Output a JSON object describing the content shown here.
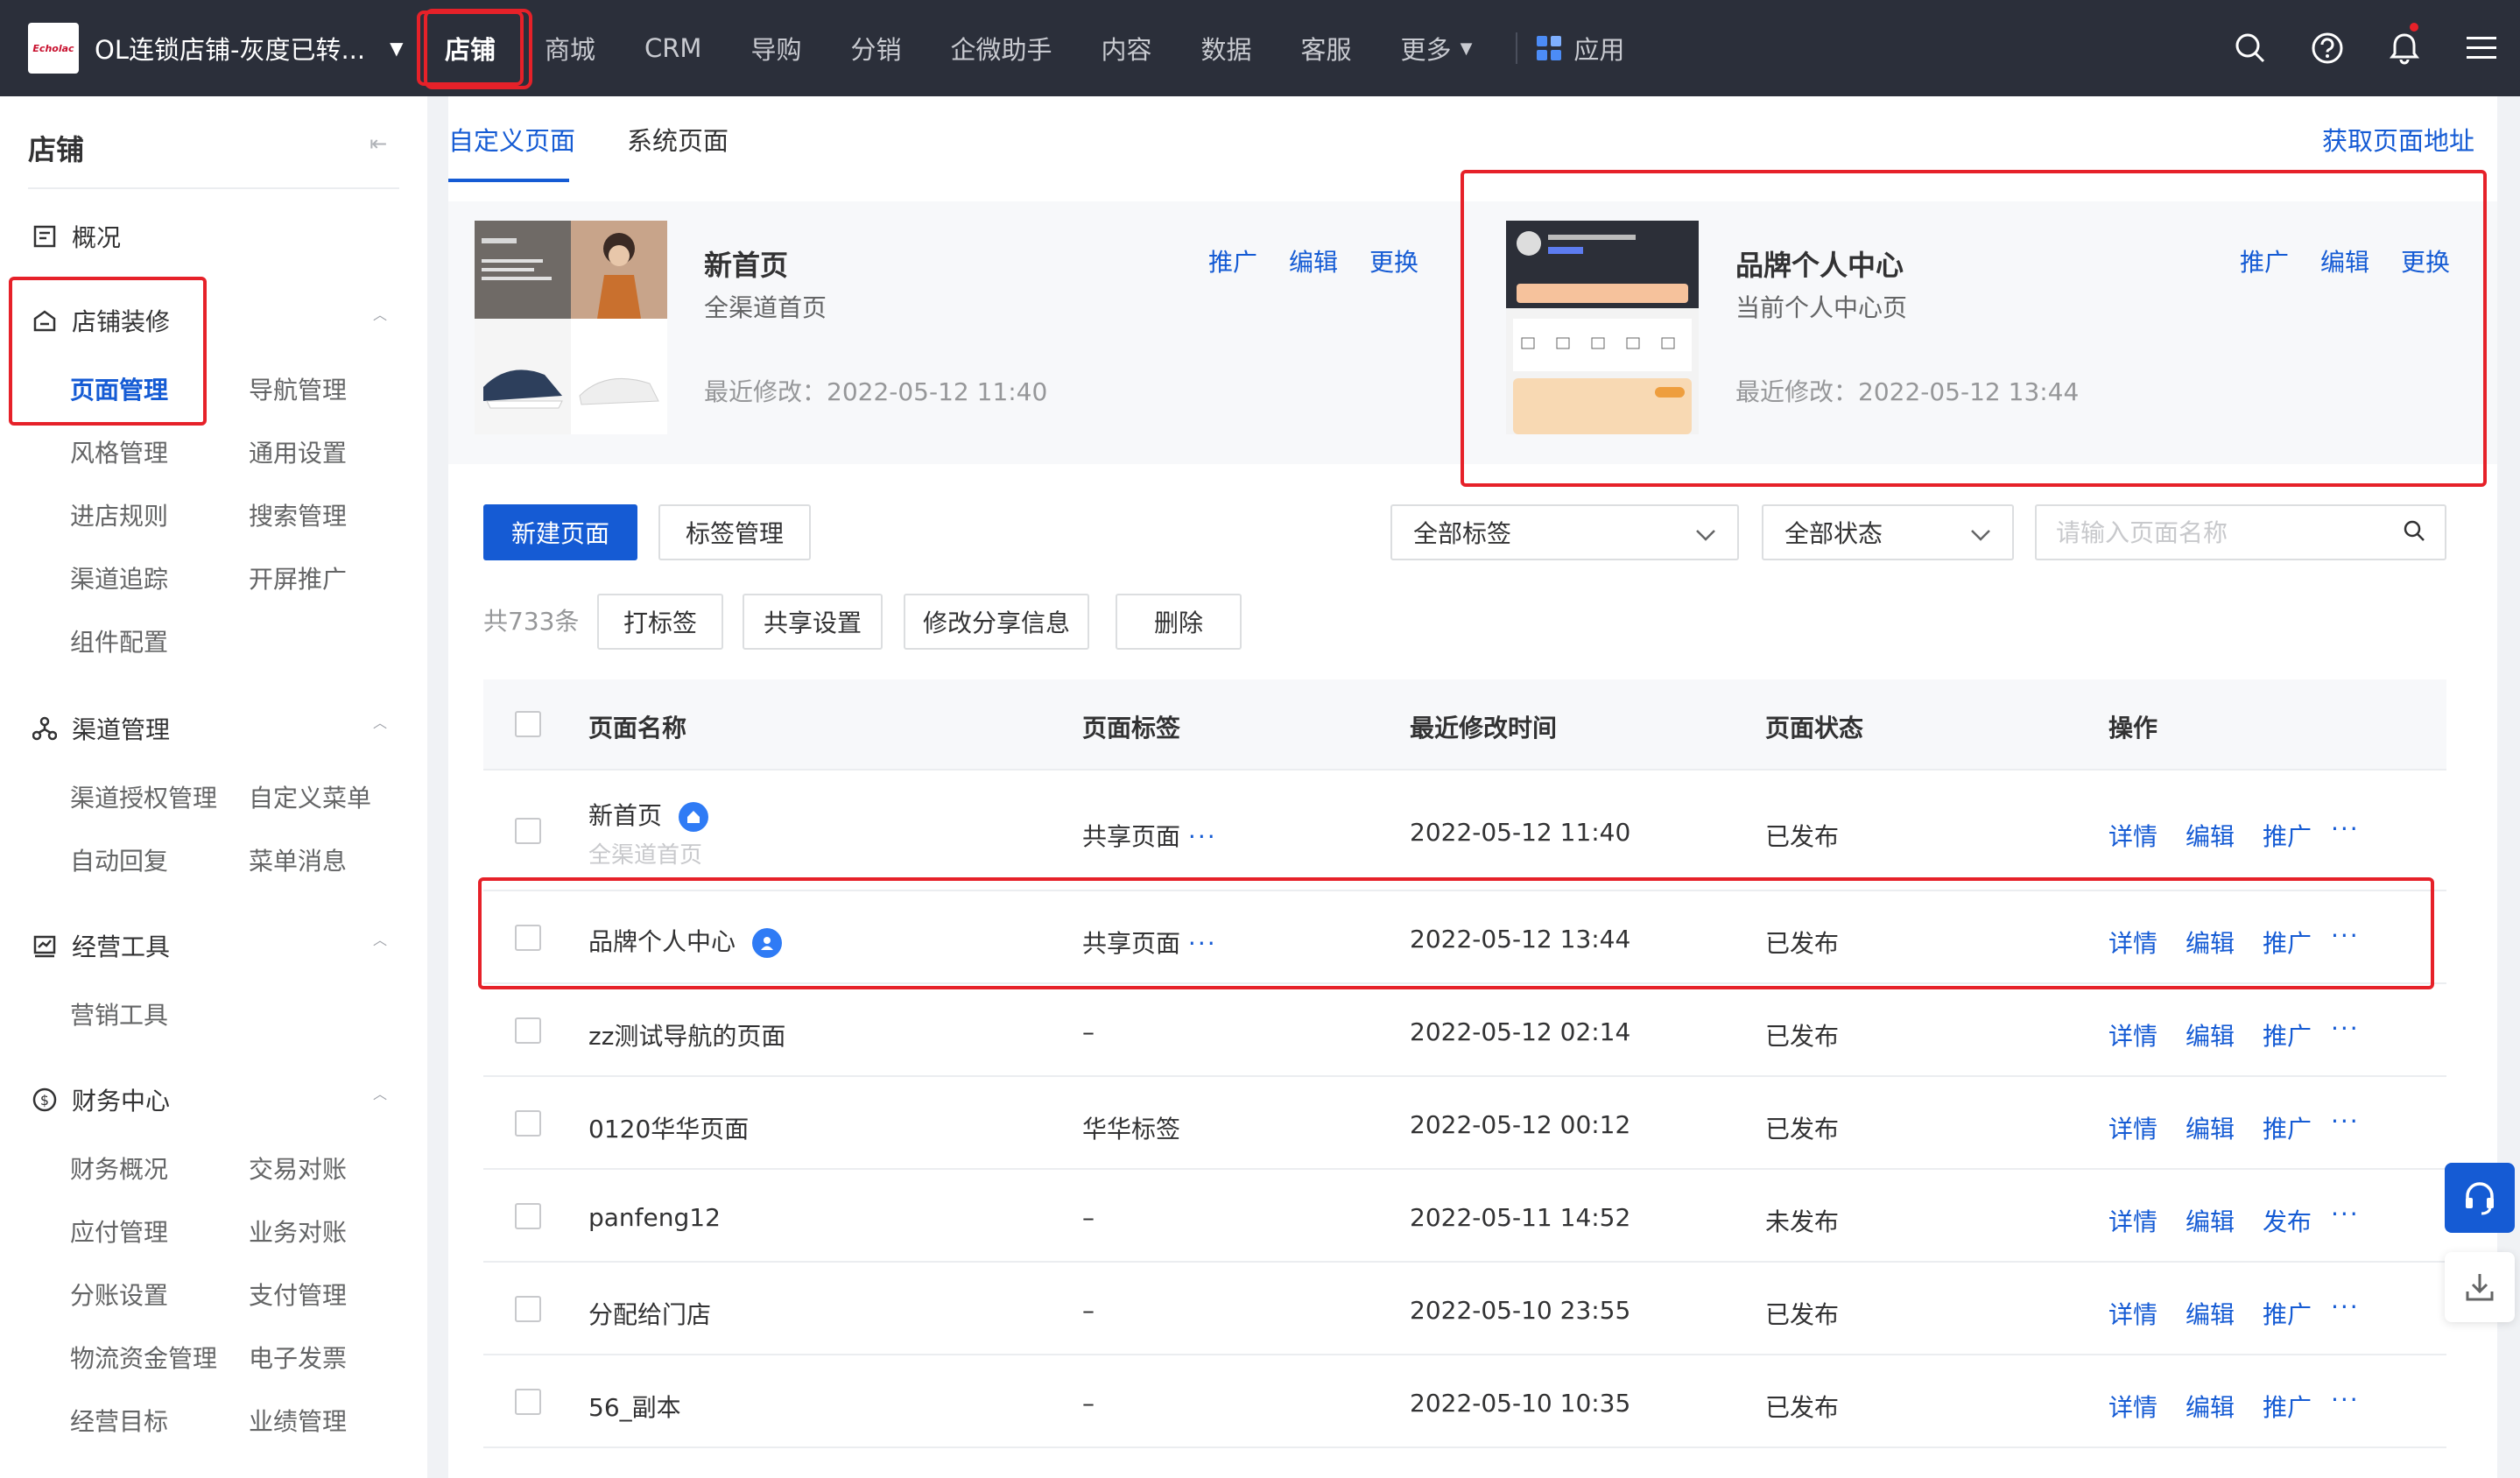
{
  "topbar": {
    "store_name": "OL连锁店铺-灰度已转...",
    "nav": [
      "店铺",
      "商城",
      "CRM",
      "导购",
      "分销",
      "企微助手",
      "内容",
      "数据",
      "客服",
      "更多"
    ],
    "apps_label": "应用"
  },
  "sidebar": {
    "title": "店铺",
    "overview": "概况",
    "groups": [
      {
        "label": "店铺装修",
        "items": [
          "页面管理",
          "导航管理",
          "风格管理",
          "通用设置",
          "进店规则",
          "搜索管理",
          "渠道追踪",
          "开屏推广",
          "组件配置"
        ]
      },
      {
        "label": "渠道管理",
        "items": [
          "渠道授权管理",
          "自定义菜单",
          "自动回复",
          "菜单消息"
        ]
      },
      {
        "label": "经营工具",
        "items": [
          "营销工具"
        ]
      },
      {
        "label": "财务中心",
        "items": [
          "财务概况",
          "交易对账",
          "应付管理",
          "业务对账",
          "分账设置",
          "支付管理",
          "物流资金管理",
          "电子发票",
          "经营目标",
          "业绩管理"
        ]
      }
    ]
  },
  "tabs": [
    "自定义页面",
    "系统页面"
  ],
  "get_page_url": "获取页面地址",
  "cards": [
    {
      "title": "新首页",
      "subtitle": "全渠道首页",
      "time": "最近修改：2022-05-12 11:40",
      "actions": [
        "推广",
        "编辑",
        "更换"
      ]
    },
    {
      "title": "品牌个人中心",
      "subtitle": "当前个人中心页",
      "time": "最近修改：2022-05-12 13:44",
      "actions": [
        "推广",
        "编辑",
        "更换"
      ]
    }
  ],
  "toolbar": {
    "new_page": "新建页面",
    "tag_manage": "标签管理",
    "all_tags": "全部标签",
    "all_status": "全部状态",
    "search_placeholder": "请输入页面名称",
    "count": "共733条",
    "batch": [
      "打标签",
      "共享设置",
      "修改分享信息",
      "删除"
    ]
  },
  "table": {
    "headers": [
      "页面名称",
      "页面标签",
      "最近修改时间",
      "页面状态",
      "操作"
    ],
    "rows": [
      {
        "name": "新首页",
        "sub": "全渠道首页",
        "tag": "共享页面",
        "time": "2022-05-12 11:40",
        "status": "已发布",
        "ops": [
          "详情",
          "编辑",
          "推广"
        ]
      },
      {
        "name": "品牌个人中心",
        "sub": "",
        "tag": "共享页面",
        "time": "2022-05-12 13:44",
        "status": "已发布",
        "ops": [
          "详情",
          "编辑",
          "推广"
        ]
      },
      {
        "name": "zz测试导航的页面",
        "sub": "",
        "tag": "–",
        "time": "2022-05-12 02:14",
        "status": "已发布",
        "ops": [
          "详情",
          "编辑",
          "推广"
        ]
      },
      {
        "name": "0120华华页面",
        "sub": "",
        "tag": "华华标签",
        "time": "2022-05-12 00:12",
        "status": "已发布",
        "ops": [
          "详情",
          "编辑",
          "推广"
        ]
      },
      {
        "name": "panfeng12",
        "sub": "",
        "tag": "–",
        "time": "2022-05-11 14:52",
        "status": "未发布",
        "ops": [
          "详情",
          "编辑",
          "发布"
        ]
      },
      {
        "name": "分配给门店",
        "sub": "",
        "tag": "–",
        "time": "2022-05-10 23:55",
        "status": "已发布",
        "ops": [
          "详情",
          "编辑",
          "推广"
        ]
      },
      {
        "name": "56_副本",
        "sub": "",
        "tag": "–",
        "time": "2022-05-10 10:35",
        "status": "已发布",
        "ops": [
          "详情",
          "编辑",
          "推广"
        ]
      }
    ]
  },
  "more_symbol": "···",
  "colors": {
    "primary": "#155bd4",
    "topbar": "#2b2f3a",
    "highlight": "#e62129"
  }
}
